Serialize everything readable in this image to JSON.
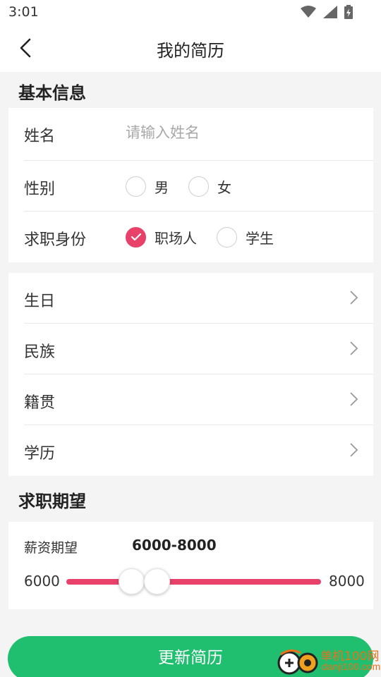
{
  "status_bar": {
    "time": "3:01"
  },
  "app_bar": {
    "title": "我的简历"
  },
  "basic_info": {
    "section_title": "基本信息",
    "name": {
      "label": "姓名",
      "placeholder": "请输入姓名",
      "value": ""
    },
    "gender": {
      "label": "性别",
      "options": [
        "男",
        "女"
      ],
      "selected": null
    },
    "identity": {
      "label": "求职身份",
      "options": [
        "职场人",
        "学生"
      ],
      "selected": "职场人"
    }
  },
  "details": [
    {
      "label": "生日"
    },
    {
      "label": "民族"
    },
    {
      "label": "籍贯"
    },
    {
      "label": "学历"
    }
  ],
  "expectation": {
    "section_title": "求职期望",
    "salary_label": "薪资期望",
    "salary_value": "6000-8000",
    "slider_min": "6000",
    "slider_max": "8000",
    "range_low_fraction": 0.255,
    "range_high_fraction": 0.355
  },
  "update_button": {
    "label": "更新简历"
  },
  "watermark": {
    "text": "单机100网",
    "sub": "danji100.com"
  },
  "colors": {
    "accent": "#e8416a",
    "primary_button": "#1fbf6f",
    "background": "#f4f4f4"
  },
  "icons": [
    "wifi-icon",
    "signal-icon",
    "battery-icon",
    "back-arrow-icon",
    "chevron-right-icon",
    "check-icon"
  ]
}
